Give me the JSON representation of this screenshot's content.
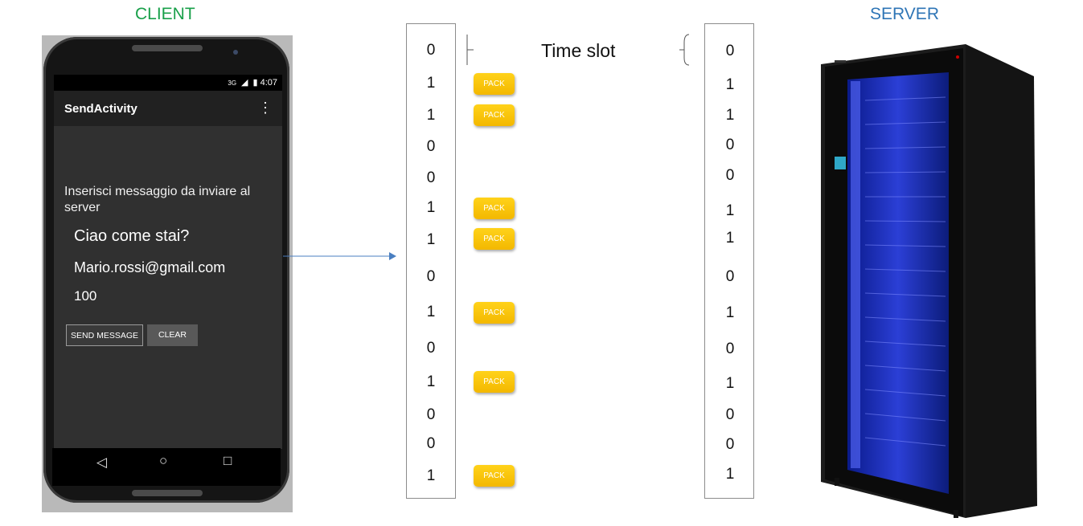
{
  "labels": {
    "client": "CLIENT",
    "server": "SERVER",
    "time_slot": "Time slot"
  },
  "colors": {
    "client_label": "#19a04a",
    "server_label": "#2e75b6",
    "pack": "#f5bd00"
  },
  "phone": {
    "status_time": "4:07",
    "status_network": "3G",
    "app_title": "SendActivity",
    "prompt": "Inserisci messaggio da inviare al server",
    "message": "Ciao come stai?",
    "email": "Mario.rossi@gmail.com",
    "amount": "100",
    "send_button": "SEND MESSAGE",
    "clear_button": "CLEAR",
    "nav": {
      "back": "◁",
      "home": "○",
      "recent": "□"
    }
  },
  "client_bits": [
    "0",
    "1",
    "1",
    "0",
    "0",
    "1",
    "1",
    "0",
    "1",
    "0",
    "1",
    "0",
    "0",
    "1"
  ],
  "server_bits": [
    "0",
    "1",
    "1",
    "0",
    "0",
    "1",
    "1",
    "0",
    "1",
    "0",
    "1",
    "0",
    "0",
    "1"
  ],
  "pack_label": "PACK",
  "packs": [
    "PACK",
    "PACK",
    "PACK",
    "PACK",
    "PACK",
    "PACK",
    "PACK"
  ]
}
